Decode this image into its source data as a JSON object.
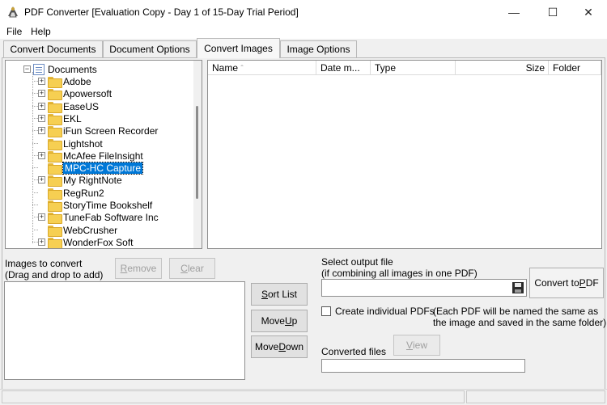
{
  "window": {
    "title": "PDF Converter [Evaluation Copy - Day 1 of 15-Day Trial Period]",
    "minimize": "—",
    "maximize": "☐",
    "close": "✕"
  },
  "menu": [
    "File",
    "Help"
  ],
  "tabs": [
    "Convert Documents",
    "Document Options",
    "Convert Images",
    "Image Options"
  ],
  "tree": {
    "root": "Documents",
    "items": [
      {
        "label": "Adobe",
        "expandable": true
      },
      {
        "label": "Apowersoft",
        "expandable": true
      },
      {
        "label": "EaseUS",
        "expandable": true
      },
      {
        "label": "EKL",
        "expandable": true
      },
      {
        "label": "iFun Screen Recorder",
        "expandable": true
      },
      {
        "label": "Lightshot",
        "expandable": false
      },
      {
        "label": "McAfee FileInsight",
        "expandable": true
      },
      {
        "label": "MPC-HC Capture",
        "expandable": false,
        "selected": true
      },
      {
        "label": "My RightNote",
        "expandable": true
      },
      {
        "label": "RegRun2",
        "expandable": false
      },
      {
        "label": "StoryTime Bookshelf",
        "expandable": false
      },
      {
        "label": "TuneFab Software Inc",
        "expandable": true
      },
      {
        "label": "WebCrusher",
        "expandable": false
      },
      {
        "label": "WonderFox Soft",
        "expandable": true
      }
    ]
  },
  "file_list": {
    "columns": [
      "Name",
      "Date m...",
      "Type",
      "Size",
      "Folder"
    ],
    "sort_indicator": "ˆ"
  },
  "images_to_convert": {
    "label_line1": "Images to convert",
    "label_line2": "(Drag and drop to add)",
    "remove": "Remove",
    "clear": "Clear"
  },
  "list_buttons": {
    "sort": "Sort List",
    "move_up": "Move Up",
    "move_down": "Move Down"
  },
  "output": {
    "label_line1": "Select output file",
    "label_line2": "(if combining all images in one PDF)",
    "value": "",
    "convert": "Convert to PDF",
    "individual_label": "Create individual PDFs",
    "individual_checked": false,
    "note_line1": "(Each PDF will be named the same as",
    "note_line2": "the image and saved in the same folder)",
    "converted_label": "Converted files",
    "view": "View",
    "converted_value": ""
  }
}
